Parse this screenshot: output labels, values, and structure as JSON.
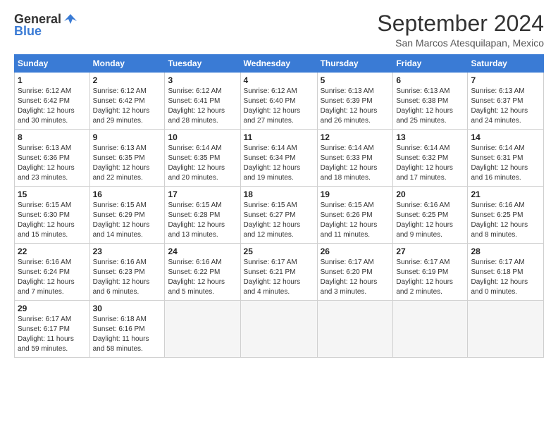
{
  "header": {
    "logo_general": "General",
    "logo_blue": "Blue",
    "month_title": "September 2024",
    "location": "San Marcos Atesquilapan, Mexico"
  },
  "weekdays": [
    "Sunday",
    "Monday",
    "Tuesday",
    "Wednesday",
    "Thursday",
    "Friday",
    "Saturday"
  ],
  "weeks": [
    [
      {
        "day": "1",
        "lines": [
          "Sunrise: 6:12 AM",
          "Sunset: 6:42 PM",
          "Daylight: 12 hours",
          "and 30 minutes."
        ]
      },
      {
        "day": "2",
        "lines": [
          "Sunrise: 6:12 AM",
          "Sunset: 6:42 PM",
          "Daylight: 12 hours",
          "and 29 minutes."
        ]
      },
      {
        "day": "3",
        "lines": [
          "Sunrise: 6:12 AM",
          "Sunset: 6:41 PM",
          "Daylight: 12 hours",
          "and 28 minutes."
        ]
      },
      {
        "day": "4",
        "lines": [
          "Sunrise: 6:12 AM",
          "Sunset: 6:40 PM",
          "Daylight: 12 hours",
          "and 27 minutes."
        ]
      },
      {
        "day": "5",
        "lines": [
          "Sunrise: 6:13 AM",
          "Sunset: 6:39 PM",
          "Daylight: 12 hours",
          "and 26 minutes."
        ]
      },
      {
        "day": "6",
        "lines": [
          "Sunrise: 6:13 AM",
          "Sunset: 6:38 PM",
          "Daylight: 12 hours",
          "and 25 minutes."
        ]
      },
      {
        "day": "7",
        "lines": [
          "Sunrise: 6:13 AM",
          "Sunset: 6:37 PM",
          "Daylight: 12 hours",
          "and 24 minutes."
        ]
      }
    ],
    [
      {
        "day": "8",
        "lines": [
          "Sunrise: 6:13 AM",
          "Sunset: 6:36 PM",
          "Daylight: 12 hours",
          "and 23 minutes."
        ]
      },
      {
        "day": "9",
        "lines": [
          "Sunrise: 6:13 AM",
          "Sunset: 6:35 PM",
          "Daylight: 12 hours",
          "and 22 minutes."
        ]
      },
      {
        "day": "10",
        "lines": [
          "Sunrise: 6:14 AM",
          "Sunset: 6:35 PM",
          "Daylight: 12 hours",
          "and 20 minutes."
        ]
      },
      {
        "day": "11",
        "lines": [
          "Sunrise: 6:14 AM",
          "Sunset: 6:34 PM",
          "Daylight: 12 hours",
          "and 19 minutes."
        ]
      },
      {
        "day": "12",
        "lines": [
          "Sunrise: 6:14 AM",
          "Sunset: 6:33 PM",
          "Daylight: 12 hours",
          "and 18 minutes."
        ]
      },
      {
        "day": "13",
        "lines": [
          "Sunrise: 6:14 AM",
          "Sunset: 6:32 PM",
          "Daylight: 12 hours",
          "and 17 minutes."
        ]
      },
      {
        "day": "14",
        "lines": [
          "Sunrise: 6:14 AM",
          "Sunset: 6:31 PM",
          "Daylight: 12 hours",
          "and 16 minutes."
        ]
      }
    ],
    [
      {
        "day": "15",
        "lines": [
          "Sunrise: 6:15 AM",
          "Sunset: 6:30 PM",
          "Daylight: 12 hours",
          "and 15 minutes."
        ]
      },
      {
        "day": "16",
        "lines": [
          "Sunrise: 6:15 AM",
          "Sunset: 6:29 PM",
          "Daylight: 12 hours",
          "and 14 minutes."
        ]
      },
      {
        "day": "17",
        "lines": [
          "Sunrise: 6:15 AM",
          "Sunset: 6:28 PM",
          "Daylight: 12 hours",
          "and 13 minutes."
        ]
      },
      {
        "day": "18",
        "lines": [
          "Sunrise: 6:15 AM",
          "Sunset: 6:27 PM",
          "Daylight: 12 hours",
          "and 12 minutes."
        ]
      },
      {
        "day": "19",
        "lines": [
          "Sunrise: 6:15 AM",
          "Sunset: 6:26 PM",
          "Daylight: 12 hours",
          "and 11 minutes."
        ]
      },
      {
        "day": "20",
        "lines": [
          "Sunrise: 6:16 AM",
          "Sunset: 6:25 PM",
          "Daylight: 12 hours",
          "and 9 minutes."
        ]
      },
      {
        "day": "21",
        "lines": [
          "Sunrise: 6:16 AM",
          "Sunset: 6:25 PM",
          "Daylight: 12 hours",
          "and 8 minutes."
        ]
      }
    ],
    [
      {
        "day": "22",
        "lines": [
          "Sunrise: 6:16 AM",
          "Sunset: 6:24 PM",
          "Daylight: 12 hours",
          "and 7 minutes."
        ]
      },
      {
        "day": "23",
        "lines": [
          "Sunrise: 6:16 AM",
          "Sunset: 6:23 PM",
          "Daylight: 12 hours",
          "and 6 minutes."
        ]
      },
      {
        "day": "24",
        "lines": [
          "Sunrise: 6:16 AM",
          "Sunset: 6:22 PM",
          "Daylight: 12 hours",
          "and 5 minutes."
        ]
      },
      {
        "day": "25",
        "lines": [
          "Sunrise: 6:17 AM",
          "Sunset: 6:21 PM",
          "Daylight: 12 hours",
          "and 4 minutes."
        ]
      },
      {
        "day": "26",
        "lines": [
          "Sunrise: 6:17 AM",
          "Sunset: 6:20 PM",
          "Daylight: 12 hours",
          "and 3 minutes."
        ]
      },
      {
        "day": "27",
        "lines": [
          "Sunrise: 6:17 AM",
          "Sunset: 6:19 PM",
          "Daylight: 12 hours",
          "and 2 minutes."
        ]
      },
      {
        "day": "28",
        "lines": [
          "Sunrise: 6:17 AM",
          "Sunset: 6:18 PM",
          "Daylight: 12 hours",
          "and 0 minutes."
        ]
      }
    ],
    [
      {
        "day": "29",
        "lines": [
          "Sunrise: 6:17 AM",
          "Sunset: 6:17 PM",
          "Daylight: 11 hours",
          "and 59 minutes."
        ]
      },
      {
        "day": "30",
        "lines": [
          "Sunrise: 6:18 AM",
          "Sunset: 6:16 PM",
          "Daylight: 11 hours",
          "and 58 minutes."
        ]
      },
      null,
      null,
      null,
      null,
      null
    ]
  ]
}
